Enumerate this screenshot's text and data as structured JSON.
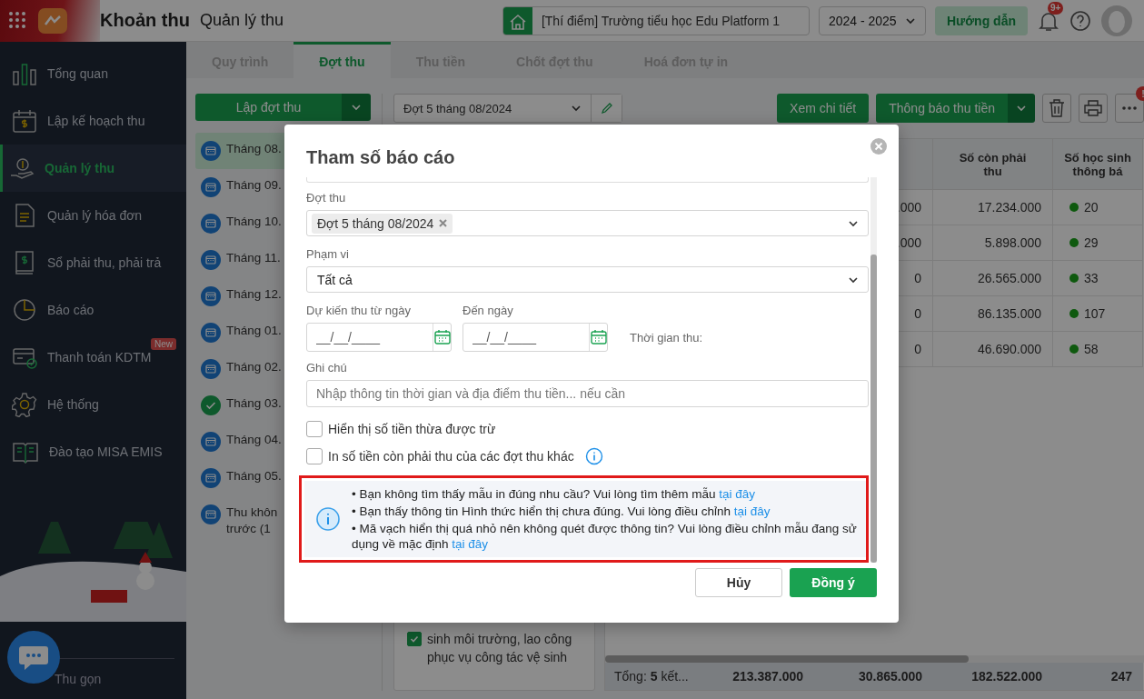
{
  "header": {
    "module": "Khoản thu",
    "page_title": "Quản lý thu",
    "school": "[Thí điểm] Trường tiểu học Edu Platform 1",
    "school_year": "2024 - 2025",
    "guide_button": "Hướng dẫn",
    "notification_badge": "9+"
  },
  "sidebar": {
    "items": [
      {
        "label": "Tổng quan",
        "kind": "chart",
        "selected": false
      },
      {
        "label": "Lập kế hoạch thu",
        "kind": "plan",
        "selected": false
      },
      {
        "label": "Quản lý thu",
        "kind": "money",
        "selected": true
      },
      {
        "label": "Quản lý hóa đơn",
        "kind": "invoice",
        "selected": false
      },
      {
        "label": "Sổ phải thu, phải trả",
        "kind": "ledger",
        "selected": false
      },
      {
        "label": "Báo cáo",
        "kind": "report",
        "selected": false
      },
      {
        "label": "Thanh toán KDTM",
        "kind": "card",
        "selected": false,
        "badge": "New"
      },
      {
        "label": "Hệ thống",
        "kind": "gear",
        "selected": false
      },
      {
        "label": "Đào tạo MISA EMIS",
        "kind": "book",
        "selected": false
      }
    ],
    "collapse": "Thu gọn"
  },
  "tabs": [
    {
      "label": "Quy trình",
      "selected": false
    },
    {
      "label": "Đợt thu",
      "selected": true
    },
    {
      "label": "Thu tiền",
      "selected": false
    },
    {
      "label": "Chốt đợt thu",
      "selected": false
    },
    {
      "label": "Hoá đơn tự in",
      "selected": false
    }
  ],
  "batches": {
    "create_button": "Lập đợt thu",
    "items": [
      {
        "label": "Tháng 08.",
        "kind": "scheduled",
        "selected": true
      },
      {
        "label": "Tháng 09.",
        "kind": "scheduled",
        "selected": false
      },
      {
        "label": "Tháng 10.",
        "kind": "scheduled",
        "selected": false
      },
      {
        "label": "Tháng 11.",
        "kind": "scheduled",
        "selected": false
      },
      {
        "label": "Tháng 12.",
        "kind": "scheduled",
        "selected": false
      },
      {
        "label": "Tháng 01.",
        "kind": "scheduled",
        "selected": false
      },
      {
        "label": "Tháng 02.",
        "kind": "scheduled",
        "selected": false
      },
      {
        "label": "Tháng 03.",
        "kind": "done",
        "selected": false
      },
      {
        "label": "Tháng 04.",
        "kind": "scheduled",
        "selected": false
      },
      {
        "label": "Tháng 05.",
        "kind": "scheduled",
        "selected": false
      },
      {
        "label": "Thu khôn",
        "label_cont": "trước (1",
        "kind": "scheduled",
        "selected": false
      }
    ]
  },
  "toolbar": {
    "batch_select": "Đợt 5 tháng 08/2024",
    "view_button": "Xem chi tiết",
    "notify_button": "Thông báo thu tiền",
    "more_alert": "!"
  },
  "fee_item": {
    "label": "sinh môi trường, lao công phục vụ công tác vệ sinh",
    "checked": true
  },
  "table": {
    "columns": [
      "Số còn phải thu",
      "Số học sinh thông bá"
    ],
    "rows": [
      {
        "column_3": ".000",
        "remaining": "17.234.000",
        "students": "20"
      },
      {
        "column_3": ".000",
        "remaining": "5.898.000",
        "students": "29"
      },
      {
        "column_3": "0",
        "remaining": "26.565.000",
        "students": "33"
      },
      {
        "column_3": "0",
        "remaining": "86.135.000",
        "students": "107"
      },
      {
        "column_3": "0",
        "remaining": "46.690.000",
        "students": "58"
      }
    ],
    "footer": {
      "label": "Tổng: **5** kết...",
      "values": [
        "213.387.000",
        "30.865.000",
        "182.522.000",
        "247"
      ]
    }
  },
  "report_dialog": {
    "title": "Tham số báo cáo",
    "batch_label": "Đợt thu",
    "batch_chip": "Đợt 5 tháng 08/2024",
    "scope_label": "Phạm vi",
    "scope_value": "Tất cả",
    "from_label": "Dự kiến thu từ ngày",
    "from_placeholder": "__/__/____",
    "to_label": "Đến ngày",
    "to_placeholder": "__/__/____",
    "time_label": "Thời gian thu:",
    "note_label": "Ghi chú",
    "note_placeholder": "Nhập thông tin thời gian và địa điểm thu tiền... nếu cần",
    "options": [
      {
        "label": "Hiển thị số tiền thừa được trừ",
        "checked": false,
        "info": false
      },
      {
        "label": "In số tiền còn phải thu của các đợt thu khác",
        "checked": false,
        "info": true
      }
    ],
    "notices": [
      {
        "text": "• Bạn không tìm thấy mẫu in đúng nhu cầu? Vui lòng tìm thêm mẫu",
        "link": "tại đây"
      },
      {
        "text": "• Bạn thấy thông tin Hình thức hiển thị chưa đúng. Vui lòng điều chỉnh",
        "link": "tại đây"
      },
      {
        "text": "• Mã vạch hiển thị quá nhỏ nên không quét được thông tin? Vui lòng điều chỉnh mẫu đang sử dụng về mặc định",
        "link": "tại đây"
      }
    ],
    "cancel": "Hủy",
    "confirm": "Đồng ý"
  }
}
